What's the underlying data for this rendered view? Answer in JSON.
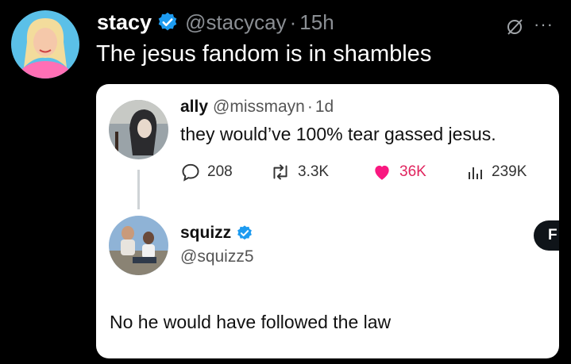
{
  "main_post": {
    "display_name": "stacy",
    "handle": "@stacycay",
    "separator": "·",
    "time": "15h",
    "text": "The jesus fandom is in shambles",
    "more_label": "···"
  },
  "quoted_post": {
    "display_name": "ally",
    "handle": "@missmayn",
    "separator": "·",
    "time": "1d",
    "text": "they would’ve 100% tear gassed jesus.",
    "stats": {
      "replies": "208",
      "retweets": "3.3K",
      "likes": "36K",
      "views": "239K"
    }
  },
  "reply_post": {
    "display_name": "squizz",
    "handle": "@squizz5",
    "text": "No he would have followed the law",
    "follow_label": "F"
  },
  "colors": {
    "verified_blue": "#1d9bf0",
    "like_pink": "#f91880",
    "background": "#000000",
    "card": "#ffffff"
  }
}
